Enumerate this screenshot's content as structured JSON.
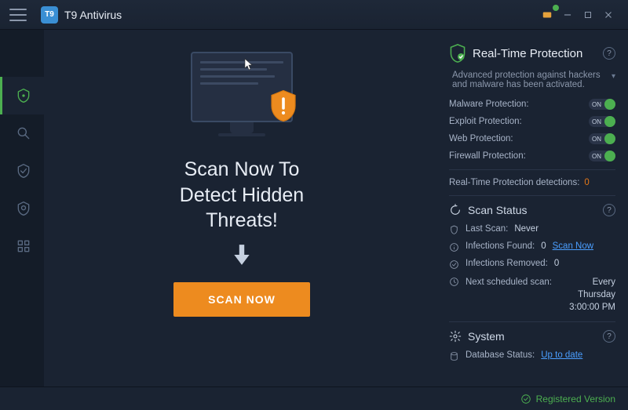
{
  "app": {
    "title": "T9 Antivirus",
    "logo_text": "T9"
  },
  "main": {
    "headline_line1": "Scan Now To",
    "headline_line2": "Detect Hidden",
    "headline_line3": "Threats!",
    "scan_button": "SCAN NOW"
  },
  "right": {
    "realtime_title": "Real-Time Protection",
    "realtime_desc": "Advanced protection against hackers and malware has been activated.",
    "protections": [
      {
        "label": "Malware Protection:",
        "state": "ON"
      },
      {
        "label": "Exploit Protection:",
        "state": "ON"
      },
      {
        "label": "Web Protection:",
        "state": "ON"
      },
      {
        "label": "Firewall Protection:",
        "state": "ON"
      }
    ],
    "detections_label": "Real-Time Protection detections:",
    "detections_count": "0",
    "scan_status_title": "Scan Status",
    "last_scan_label": "Last Scan:",
    "last_scan_value": "Never",
    "infections_found_label": "Infections Found:",
    "infections_found_value": "0",
    "scan_now_link": "Scan Now",
    "infections_removed_label": "Infections Removed:",
    "infections_removed_value": "0",
    "next_scan_label": "Next scheduled scan:",
    "next_scan_value": "Every Thursday 3:00:00 PM",
    "system_title": "System",
    "db_status_label": "Database Status:",
    "db_status_value": "Up to date"
  },
  "footer": {
    "registered": "Registered Version"
  },
  "colors": {
    "accent_orange": "#ed8b1f",
    "accent_green": "#4caf50",
    "link_blue": "#4a9eff"
  }
}
